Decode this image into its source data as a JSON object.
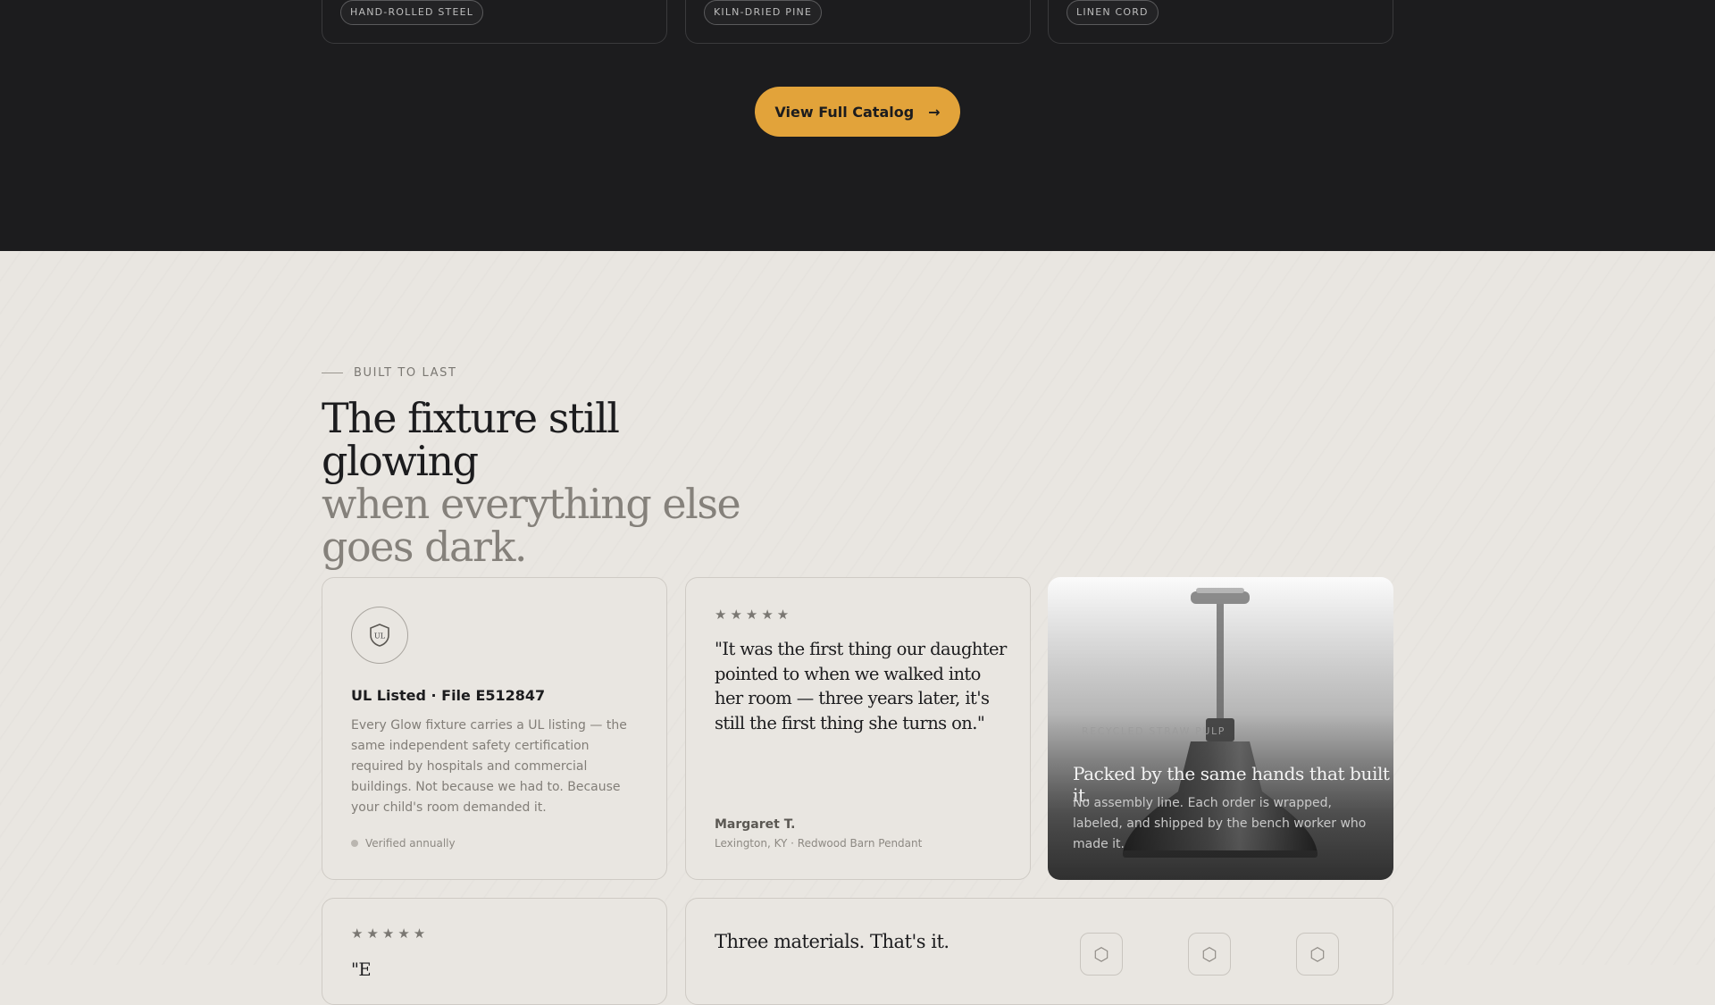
{
  "materials_top": [
    {
      "tag": "HAND-ROLLED STEEL"
    },
    {
      "tag": "KILN-DRIED PINE"
    },
    {
      "tag": "LINEN CORD"
    }
  ],
  "cta": {
    "label": "View Full Catalog",
    "arrow": "→"
  },
  "section": {
    "eyebrow": "BUILT TO LAST",
    "title_line1": "The fixture still glowing",
    "title_line2": "when everything else goes dark."
  },
  "ul_card": {
    "badge_text": "UL",
    "title": "UL Listed · File E512847",
    "body": "Every Glow fixture carries a UL listing — the same independent safety certification required by hospitals and commercial buildings. Not because we had to. Because your child's room demanded it.",
    "footnote": "Verified annually"
  },
  "review_1": {
    "stars": "★★★★★",
    "quote": "\"It was the first thing our daughter pointed to when we walked into her room — three years later, it's still the first thing she turns on.\"",
    "author": "Margaret T.",
    "meta": "Lexington, KY · Redwood Barn Pendant"
  },
  "packing_card": {
    "eyebrow": "RECYCLED STRAW PULP",
    "title": "Packed by the same hands that built it.",
    "body": "No assembly line. Each order is wrapped, labeled, and shipped by the bench worker who made it."
  },
  "review_2": {
    "stars": "★★★★★",
    "quote_partial": "\"E"
  },
  "materials_card": {
    "title": "Three materials. That's it.",
    "icons": [
      "hexagon-icon",
      "hexagon-icon",
      "hexagon-icon"
    ]
  },
  "colors": {
    "accent": "#e2a33a",
    "dark": "#1c1c1e",
    "background": "#e9e6e1"
  }
}
